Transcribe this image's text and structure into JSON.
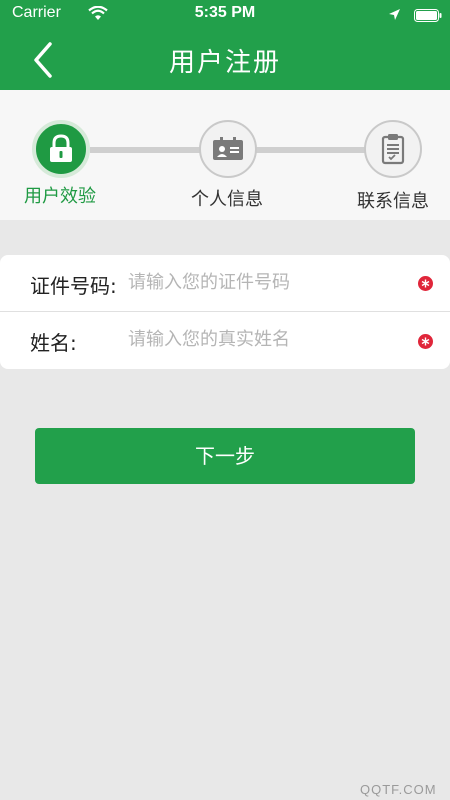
{
  "status_bar": {
    "carrier": "Carrier",
    "time": "5:35 PM"
  },
  "header": {
    "title": "用户注册",
    "back_icon": "chevron-left-icon"
  },
  "steps": [
    {
      "label": "用户效验",
      "icon": "lock-icon",
      "active": true
    },
    {
      "label": "个人信息",
      "icon": "id-card-icon",
      "active": false
    },
    {
      "label": "联系信息",
      "icon": "clipboard-icon",
      "active": false
    }
  ],
  "form": {
    "id_number": {
      "label": "证件号码:",
      "placeholder": "请输入您的证件号码",
      "value": ""
    },
    "name": {
      "label": "姓名:",
      "placeholder": "请输入您的真实姓名",
      "value": ""
    }
  },
  "next_button": {
    "label": "下一步"
  },
  "watermark": "QQTF.COM",
  "colors": {
    "primary": "#22a04b",
    "required": "#e0263a",
    "inactive": "#c9c9c9"
  }
}
